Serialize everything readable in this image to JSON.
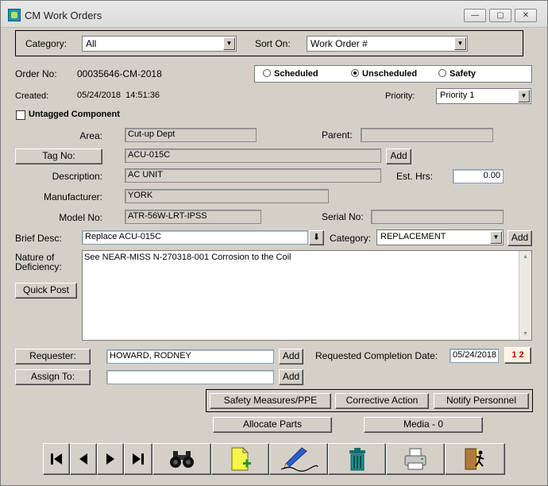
{
  "window": {
    "title": "CM Work Orders"
  },
  "filter": {
    "category_label": "Category:",
    "category_value": "All",
    "sort_label": "Sort On:",
    "sort_value": "Work Order #"
  },
  "order": {
    "order_no_label": "Order No:",
    "order_no": "00035646-CM-2018",
    "created_label": "Created:",
    "created_value": "05/24/2018  14:51:36"
  },
  "schedule": {
    "options": [
      "Scheduled",
      "Unscheduled",
      "Safety"
    ],
    "selected": "Unscheduled"
  },
  "priority": {
    "label": "Priority:",
    "value": "Priority 1"
  },
  "untagged": {
    "label": "Untagged Component",
    "checked": false
  },
  "area": {
    "label": "Area:",
    "value": "Cut-up Dept"
  },
  "parent": {
    "label": "Parent:",
    "value": ""
  },
  "tag": {
    "button": "Tag No:",
    "value": "ACU-015C",
    "add": "Add"
  },
  "description": {
    "label": "Description:",
    "value": "AC UNIT"
  },
  "est_hrs": {
    "label": "Est. Hrs:",
    "value": "0.00"
  },
  "manufacturer": {
    "label": "Manufacturer:",
    "value": "YORK"
  },
  "model": {
    "label": "Model No:",
    "value": "ATR-56W-LRT-IPSS"
  },
  "serial": {
    "label": "Serial No:",
    "value": ""
  },
  "brief": {
    "label": "Brief Desc:",
    "value": "Replace ACU-015C"
  },
  "category2": {
    "label": "Category:",
    "value": "REPLACEMENT",
    "add": "Add"
  },
  "nature": {
    "label": "Nature of Deficiency:",
    "value": "See NEAR-MISS N-270318-001 Corrosion to the Coil",
    "quick_post": "Quick Post"
  },
  "requester": {
    "button": "Requester:",
    "value": "HOWARD, RODNEY",
    "add": "Add"
  },
  "completion": {
    "label": "Requested Completion Date:",
    "value": "05/24/2018"
  },
  "assign": {
    "button": "Assign To:",
    "value": "",
    "add": "Add"
  },
  "actions": {
    "safety": "Safety Measures/PPE",
    "corrective": "Corrective Action",
    "notify": "Notify Personnel",
    "allocate": "Allocate Parts",
    "media": "Media - 0"
  },
  "calendar": {
    "label": "1 2"
  },
  "colors": {
    "accent": "#1e8fbf",
    "window_bg": "#d4d0c8"
  },
  "toolbar": [
    "first-record-icon",
    "previous-record-icon",
    "next-record-icon",
    "last-record-icon",
    "binoculars-icon",
    "new-document-icon",
    "signature-pen-icon",
    "trash-can-icon",
    "printer-icon",
    "exit-door-icon"
  ]
}
